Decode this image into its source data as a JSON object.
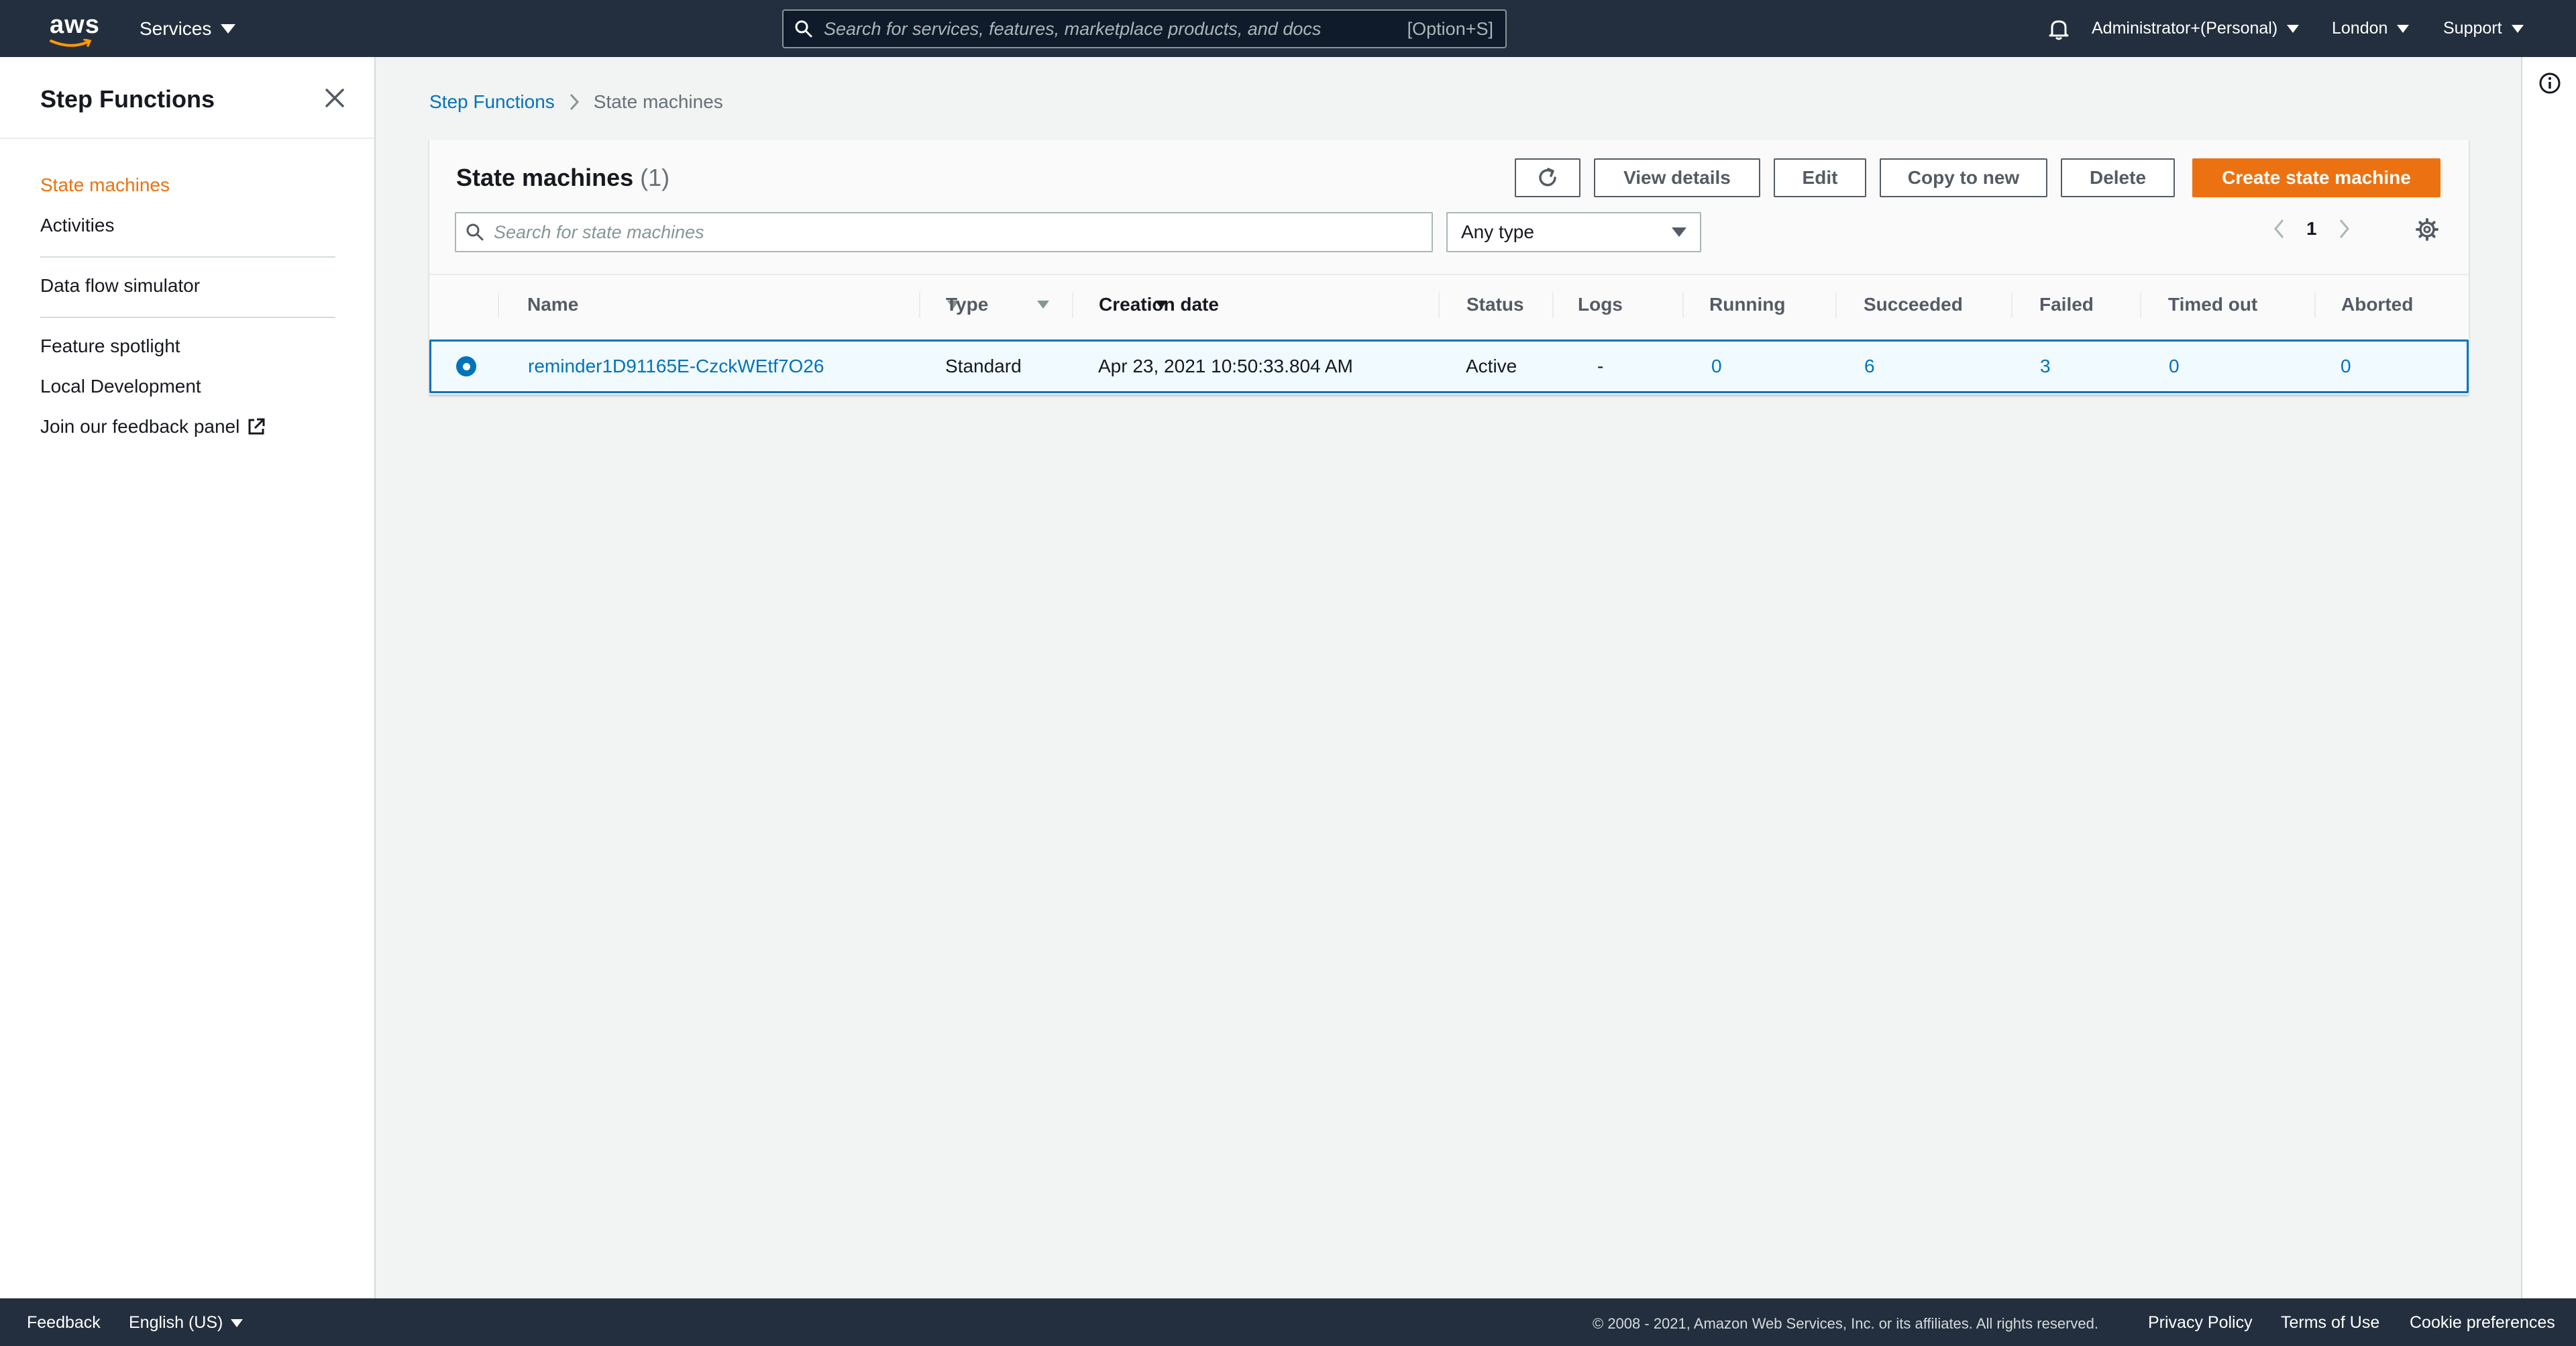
{
  "topnav": {
    "logo_text": "aws",
    "services_label": "Services",
    "search_placeholder": "Search for services, features, marketplace products, and docs",
    "search_shortcut": "[Option+S]",
    "account_label": "Administrator+(Personal)",
    "region_label": "London",
    "support_label": "Support"
  },
  "sidebar": {
    "title": "Step Functions",
    "items": [
      {
        "label": "State machines",
        "active": true
      },
      {
        "label": "Activities"
      },
      {
        "label": "Data flow simulator"
      },
      {
        "label": "Feature spotlight"
      },
      {
        "label": "Local Development"
      },
      {
        "label": "Join our feedback panel",
        "external": true
      }
    ]
  },
  "breadcrumb": {
    "root": "Step Functions",
    "current": "State machines"
  },
  "panel": {
    "title": "State machines",
    "count": "(1)",
    "buttons": {
      "view_details": "View details",
      "edit": "Edit",
      "copy_to_new": "Copy to new",
      "delete": "Delete",
      "create": "Create state machine"
    },
    "search_placeholder": "Search for state machines",
    "type_filter": "Any type",
    "page_number": "1"
  },
  "table": {
    "columns": [
      "Name",
      "Type",
      "Creation date",
      "Status",
      "Logs",
      "Running",
      "Succeeded",
      "Failed",
      "Timed out",
      "Aborted"
    ],
    "rows": [
      {
        "name": "reminder1D91165E-CzckWEtf7O26",
        "type": "Standard",
        "creation_date": "Apr 23, 2021 10:50:33.804 AM",
        "status": "Active",
        "logs": "-",
        "running": "0",
        "succeeded": "6",
        "failed": "3",
        "timed_out": "0",
        "aborted": "0",
        "selected": true
      }
    ]
  },
  "footer": {
    "feedback": "Feedback",
    "language": "English (US)",
    "copyright": "© 2008 - 2021, Amazon Web Services, Inc. or its affiliates. All rights reserved.",
    "privacy": "Privacy Policy",
    "terms": "Terms of Use",
    "cookies": "Cookie preferences"
  },
  "colors": {
    "nav_bg": "#232f3e",
    "accent_orange": "#ec7211",
    "link_blue": "#0073bb",
    "selected_row_bg": "#f1faff"
  }
}
